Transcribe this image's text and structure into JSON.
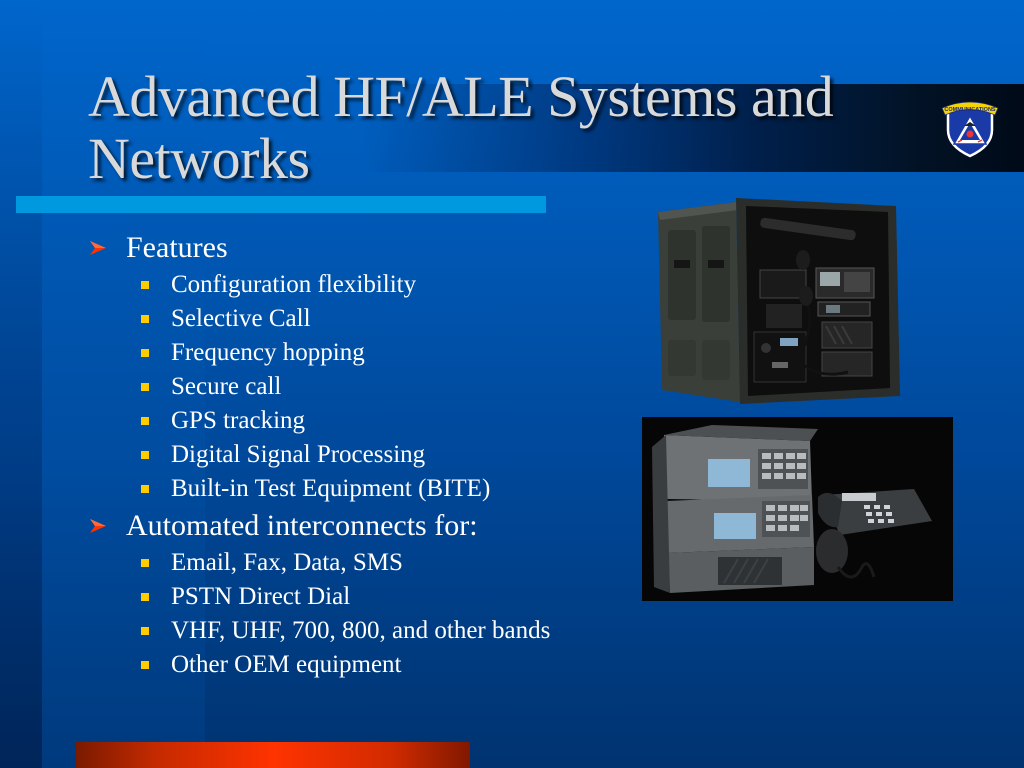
{
  "slide": {
    "title_line1": "Advanced HF/ALE Systems and",
    "title_line2": "Networks",
    "logo": {
      "icon": "communications-shield-logo",
      "banner_text": "COMMUNICATIONS"
    },
    "colors": {
      "background": "#0066cc",
      "title_text": "#d9d9d9",
      "title_underline": "#0099e0",
      "bullet_arrow": "#ff3300",
      "bullet_square": "#ffcc00",
      "bottom_bar": "#ff3300"
    },
    "bullets": [
      {
        "label": "Features",
        "icon": "arrowhead-bullet",
        "items": [
          "Configuration flexibility",
          "Selective Call",
          "Frequency hopping",
          "Secure call",
          "GPS tracking",
          "Digital Signal Processing",
          "Built-in Test Equipment (BITE)"
        ]
      },
      {
        "label": "Automated interconnects for:",
        "icon": "arrowhead-bullet",
        "items": [
          "Email, Fax, Data, SMS",
          "PSTN Direct Dial",
          "VHF, UHF, 700, 800, and other bands",
          "Other OEM equipment"
        ]
      }
    ],
    "images": [
      {
        "name": "transit-case-radio-system",
        "alt": "HF radio equipment mounted in rugged transit case"
      },
      {
        "name": "stacked-hf-radios-with-phone",
        "alt": "Stacked HF radio units with handset microphone and telephone"
      }
    ]
  }
}
